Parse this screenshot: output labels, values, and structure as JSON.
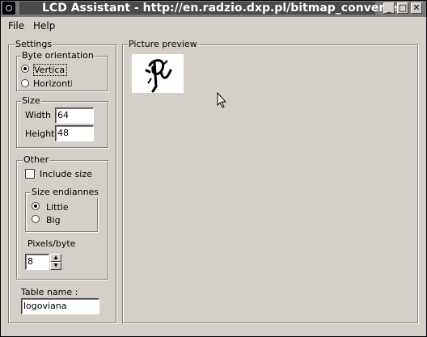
{
  "window": {
    "title": "LCD Assistant -  http://en.radzio.dxp.pl/bitmap_converter/",
    "minimize_glyph": "_",
    "maximize_glyph": "□",
    "close_glyph": "✕"
  },
  "menu": {
    "file": "File",
    "help": "Help"
  },
  "settings": {
    "legend": "Settings",
    "byte_orientation": {
      "legend": "Byte orientation",
      "vertical": "Vertica",
      "horizontal": "Horizonti",
      "selected": "vertical"
    },
    "size": {
      "legend": "Size",
      "width_label": "Width",
      "width_value": "64",
      "height_label": "Height",
      "height_value": "48"
    },
    "other": {
      "legend": "Other",
      "include_size": "Include size",
      "include_size_checked": false,
      "endianness": {
        "legend": "Size endiannes",
        "little": "Little",
        "big": "Big",
        "selected": "little"
      },
      "pixels_byte_label": "Pixels/byte",
      "pixels_byte_value": "8"
    },
    "table_name_label": "Table name :",
    "table_name_value": "logoviana"
  },
  "preview": {
    "legend": "Picture preview"
  },
  "colors": {
    "titlebar": "#7a7a7a",
    "title_highlight": "#4a4a4a",
    "face": "#d4d0c8"
  }
}
